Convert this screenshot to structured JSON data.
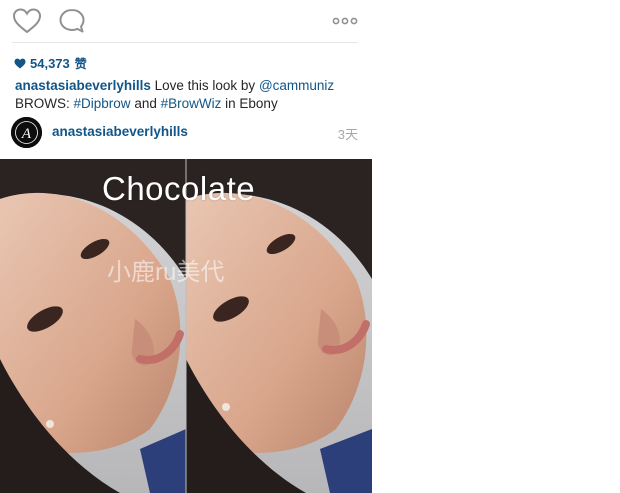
{
  "actions": {
    "like_icon": "heart-outline-icon",
    "comment_icon": "speech-bubble-icon",
    "more_icon": "ellipsis-icon"
  },
  "likes": {
    "icon": "heart-filled-icon",
    "count": "54,373",
    "suffix": "赞"
  },
  "caption": {
    "username": "anastasiabeverlyhills",
    "text_1": "Love this look by",
    "mention": "@cammuniz",
    "text_2": "BROWS:",
    "hashtag_1": "#Dipbrow",
    "text_3": "and",
    "hashtag_2": "#BrowWiz",
    "text_4": "in Ebony"
  },
  "comment": {
    "username": "anastasiabeverlyhills",
    "time": "3天",
    "avatar_letter": "A"
  },
  "photo": {
    "overlay_title": "Chocolate",
    "watermark": "小鹿ru美代"
  },
  "colors": {
    "link": "#125688",
    "text": "#262626",
    "muted": "#a5a7aa"
  }
}
